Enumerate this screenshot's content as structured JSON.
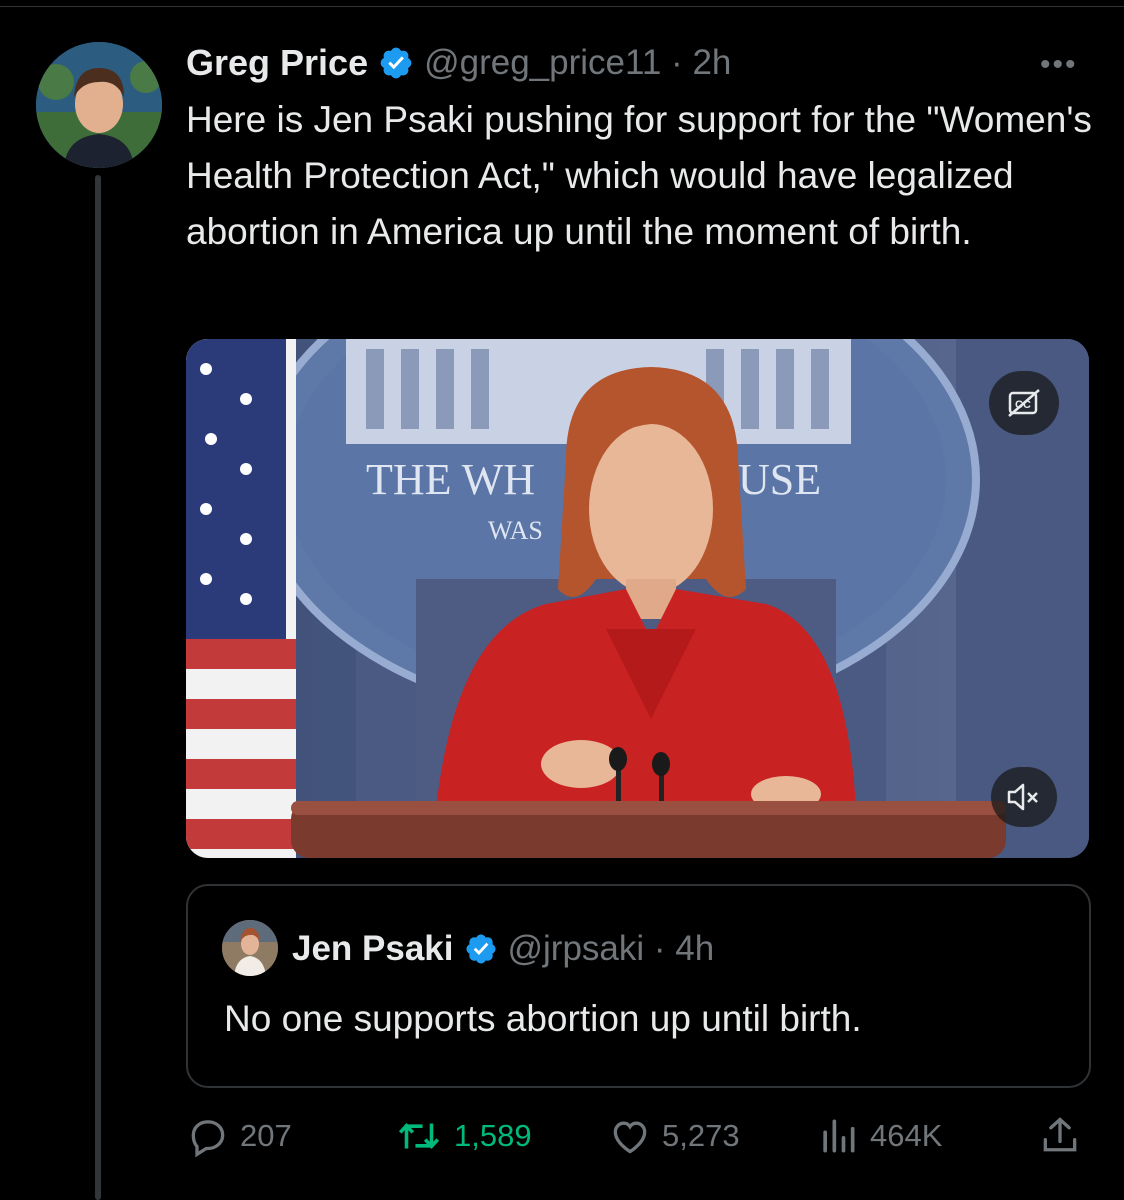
{
  "tweet": {
    "author_name": "Greg Price",
    "handle_time": "@greg_price11 · 2h",
    "more_icon": "more-horizontal-icon",
    "text": "Here is Jen Psaki pushing for support for the \"Women's Health Protection Act,\" which would have legalized abortion in America up until the moment of birth."
  },
  "media": {
    "seal_text_left": "THE WH",
    "seal_text_right": "USE",
    "seal_subtext": "WAS",
    "cc_icon": "closed-captions-off-icon",
    "mute_icon": "volume-muted-icon"
  },
  "quote": {
    "author_name": "Jen Psaki",
    "handle_time": "@jrpsaki · 4h",
    "text": "No one supports abortion up until birth."
  },
  "actions": {
    "replies": "207",
    "reposts": "1,589",
    "likes": "5,273",
    "views": "464K"
  },
  "colors": {
    "background": "#000000",
    "text": "#e7e9ea",
    "muted": "#71767b",
    "verified": "#1d9bf0",
    "repost_active": "#00ba7c",
    "border": "#2f3336"
  }
}
